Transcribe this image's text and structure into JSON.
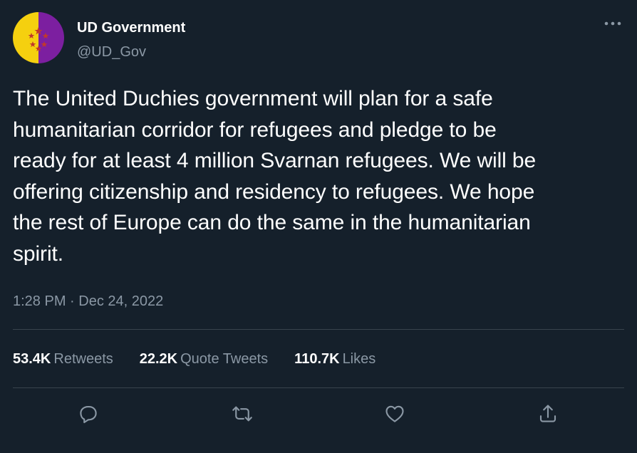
{
  "author": {
    "display_name": "UD Government",
    "handle": "@UD_Gov",
    "avatar_icon": "flag-stars-avatar",
    "avatar_colors": {
      "left": "#f5d00f",
      "right": "#7c1fa0",
      "stars": "#c0392b"
    }
  },
  "tweet": {
    "text": "The United Duchies government will plan for a safe\nhumanitarian corridor for refugees and pledge to be\nready for at least 4 million Svarnan refugees. We will be\noffering citizenship and residency to refugees. We hope\nthe rest of Europe can do the same in the humanitarian\nspirit.",
    "timestamp": "1:28 PM · Dec 24, 2022"
  },
  "stats": {
    "retweets": {
      "count": "53.4K",
      "label": "Retweets"
    },
    "quote_tweets": {
      "count": "22.2K",
      "label": "Quote Tweets"
    },
    "likes": {
      "count": "110.7K",
      "label": "Likes"
    }
  },
  "actions": {
    "reply_icon": "reply-icon",
    "retweet_icon": "retweet-icon",
    "like_icon": "heart-icon",
    "share_icon": "share-icon",
    "more_icon": "more-icon"
  },
  "colors": {
    "background": "#15202b",
    "text_primary": "#ffffff",
    "text_secondary": "#8b98a5",
    "divider": "#38444d",
    "icon": "#8b98a5"
  }
}
